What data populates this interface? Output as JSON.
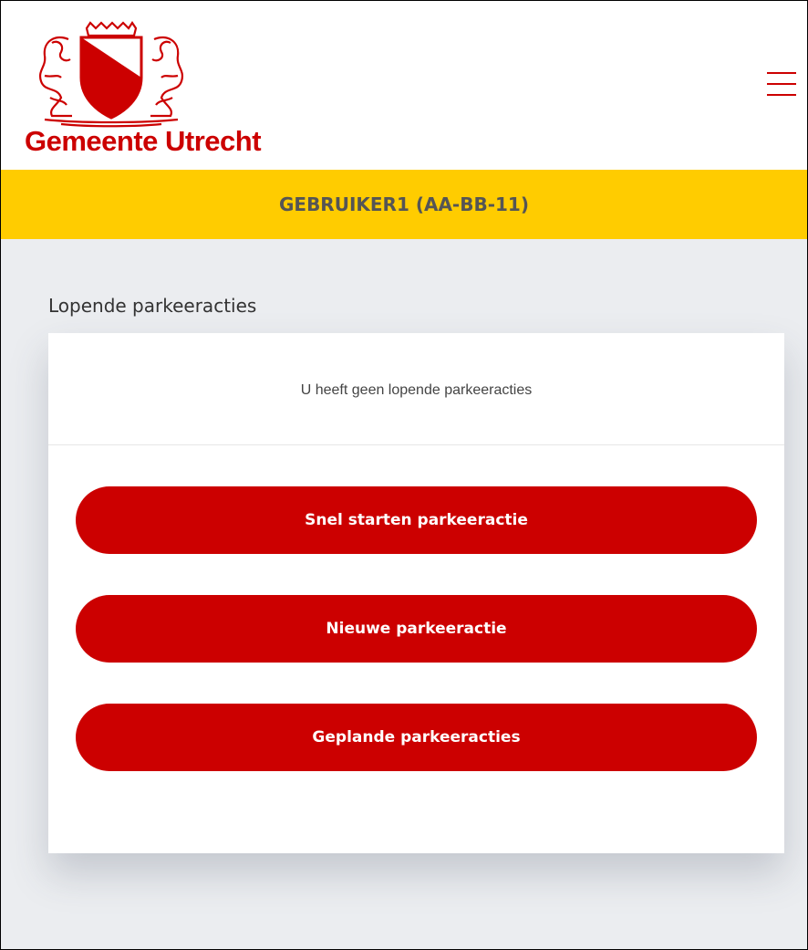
{
  "colors": {
    "brand_red": "#cc0000",
    "banner_yellow": "#ffcc00",
    "page_background": "#ebedf0",
    "text_dark": "#555555"
  },
  "header": {
    "logo_text": "Gemeente Utrecht",
    "logo_icon": "coat-of-arms-icon",
    "menu_icon": "hamburger-menu-icon"
  },
  "user_bar": {
    "label": "GEBRUIKER1 (AA-BB-11)"
  },
  "main": {
    "section_title": "Lopende parkeeracties",
    "empty_message": "U heeft geen lopende parkeeracties",
    "buttons": [
      {
        "label": "Snel starten parkeeractie"
      },
      {
        "label": "Nieuwe parkeeractie"
      },
      {
        "label": "Geplande parkeeracties"
      }
    ]
  }
}
